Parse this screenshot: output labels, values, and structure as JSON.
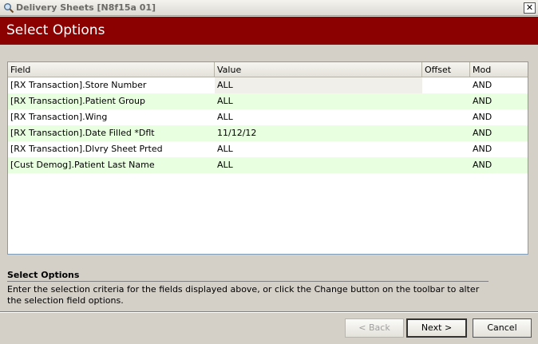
{
  "window": {
    "title": "Delivery Sheets [N8f15a 01]",
    "close_glyph": "✕"
  },
  "header": {
    "title": "Select Options"
  },
  "grid": {
    "columns": [
      "Field",
      "Value",
      "Offset",
      "Mod"
    ],
    "rows": [
      {
        "field": "[RX Transaction].Store Number",
        "value": "ALL",
        "offset": "",
        "mod": "AND"
      },
      {
        "field": "[RX Transaction].Patient Group",
        "value": "ALL",
        "offset": "",
        "mod": "AND"
      },
      {
        "field": "[RX Transaction].Wing",
        "value": "ALL",
        "offset": "",
        "mod": "AND"
      },
      {
        "field": "[RX Transaction].Date Filled *Dflt",
        "value": "11/12/12",
        "offset": "",
        "mod": "AND"
      },
      {
        "field": "[RX Transaction].Dlvry Sheet Prted",
        "value": "ALL",
        "offset": "",
        "mod": "AND"
      },
      {
        "field": "[Cust Demog].Patient Last Name",
        "value": "ALL",
        "offset": "",
        "mod": "AND"
      }
    ]
  },
  "info": {
    "title": "Select Options",
    "text": "Enter the selection criteria for the fields displayed above, or click the Change button on the toolbar to alter the selection field options."
  },
  "buttons": {
    "back": "< Back",
    "next": "Next >",
    "cancel": "Cancel"
  },
  "icons": {
    "app": "magnifier-icon"
  }
}
